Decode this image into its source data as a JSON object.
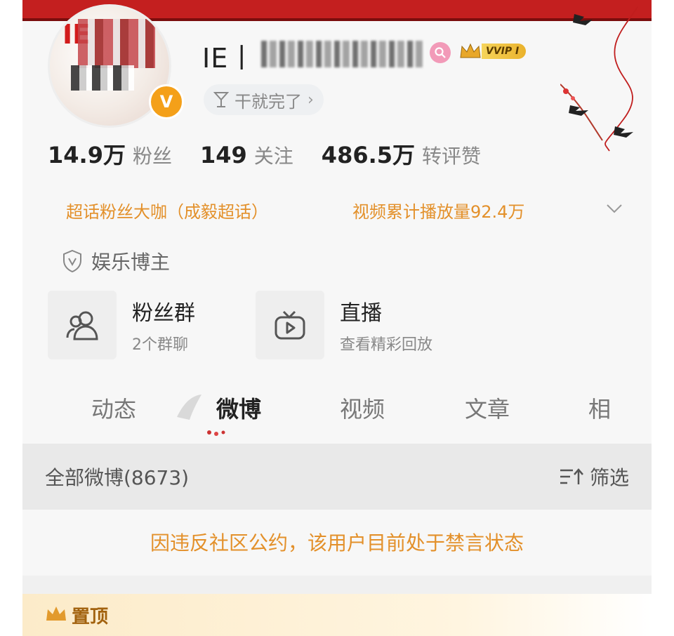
{
  "profile": {
    "username_prefix": "IE丨",
    "username_rest": "法锤网安·梁",
    "motto": "干就完了",
    "verified_symbol": "V",
    "vip_label": "VVIP I",
    "avatar_text": "IE"
  },
  "stats": [
    {
      "value": "14.9万",
      "label": "粉丝"
    },
    {
      "value": "149",
      "label": "关注"
    },
    {
      "value": "486.5万",
      "label": "转评赞"
    }
  ],
  "taglines": {
    "super_topic": "超话粉丝大咖（成毅超话）",
    "video_plays": "视频累计播放量92.4万"
  },
  "category": "娱乐博主",
  "quick_cards": [
    {
      "title": "粉丝群",
      "subtitle": "2个群聊",
      "icon": "people-icon"
    },
    {
      "title": "直播",
      "subtitle": "查看精彩回放",
      "icon": "tv-play-icon"
    }
  ],
  "tabs": [
    "动态",
    "微博",
    "视频",
    "文章",
    "相"
  ],
  "active_tab": "微博",
  "feed": {
    "title": "全部微博(8673)",
    "filter_label": "筛选"
  },
  "notice": "因违反社区公约，该用户目前处于禁言状态",
  "pinned_label": "置顶",
  "colors": {
    "accent_orange": "#e3902a",
    "banner_red": "#c41f1f",
    "vip_gold": "#eab22c",
    "verified_orange": "#f4a019"
  }
}
